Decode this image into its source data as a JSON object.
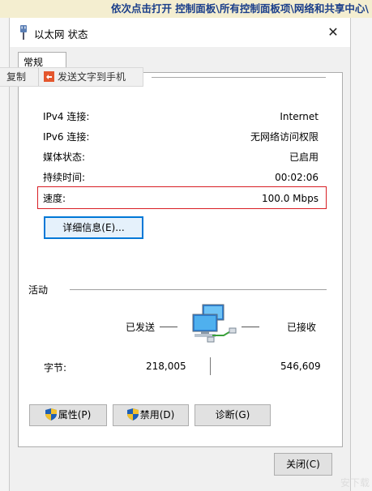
{
  "banner": {
    "text": "依次点击打开 控制面板\\所有控制面板项\\网络和共享中心\\"
  },
  "window": {
    "title": "以太网 状态",
    "close_glyph": "✕"
  },
  "tab": {
    "label": "常规"
  },
  "ext_toolbar": {
    "copy_label": "复制",
    "send_label": "发送文字到手机"
  },
  "connection": {
    "ipv4_label": "IPv4 连接:",
    "ipv4_value": "Internet",
    "ipv6_label": "IPv6 连接:",
    "ipv6_value": "无网络访问权限",
    "media_label": "媒体状态:",
    "media_value": "已启用",
    "duration_label": "持续时间:",
    "duration_value": "00:02:06",
    "speed_label": "速度:",
    "speed_value": "100.0 Mbps"
  },
  "details_button": "详细信息(E)...",
  "activity": {
    "section_label": "活动",
    "sent_label": "已发送",
    "received_label": "已接收",
    "bytes_label": "字节:",
    "bytes_sent": "218,005",
    "bytes_received": "546,609"
  },
  "buttons": {
    "properties": "属性(P)",
    "disable": "禁用(D)",
    "diagnose": "诊断(G)",
    "close": "关闭(C)"
  },
  "watermark": "安下载",
  "colors": {
    "highlight_box": "#d81e24",
    "focus_blue": "#0078d7",
    "banner_text": "#1a3e8a",
    "banner_bg": "#f4eed0"
  },
  "icons": {
    "title": "ethernet-plug-icon",
    "network": "network-computers-icon",
    "send": "send-to-phone-icon",
    "shield": "uac-shield-icon"
  }
}
